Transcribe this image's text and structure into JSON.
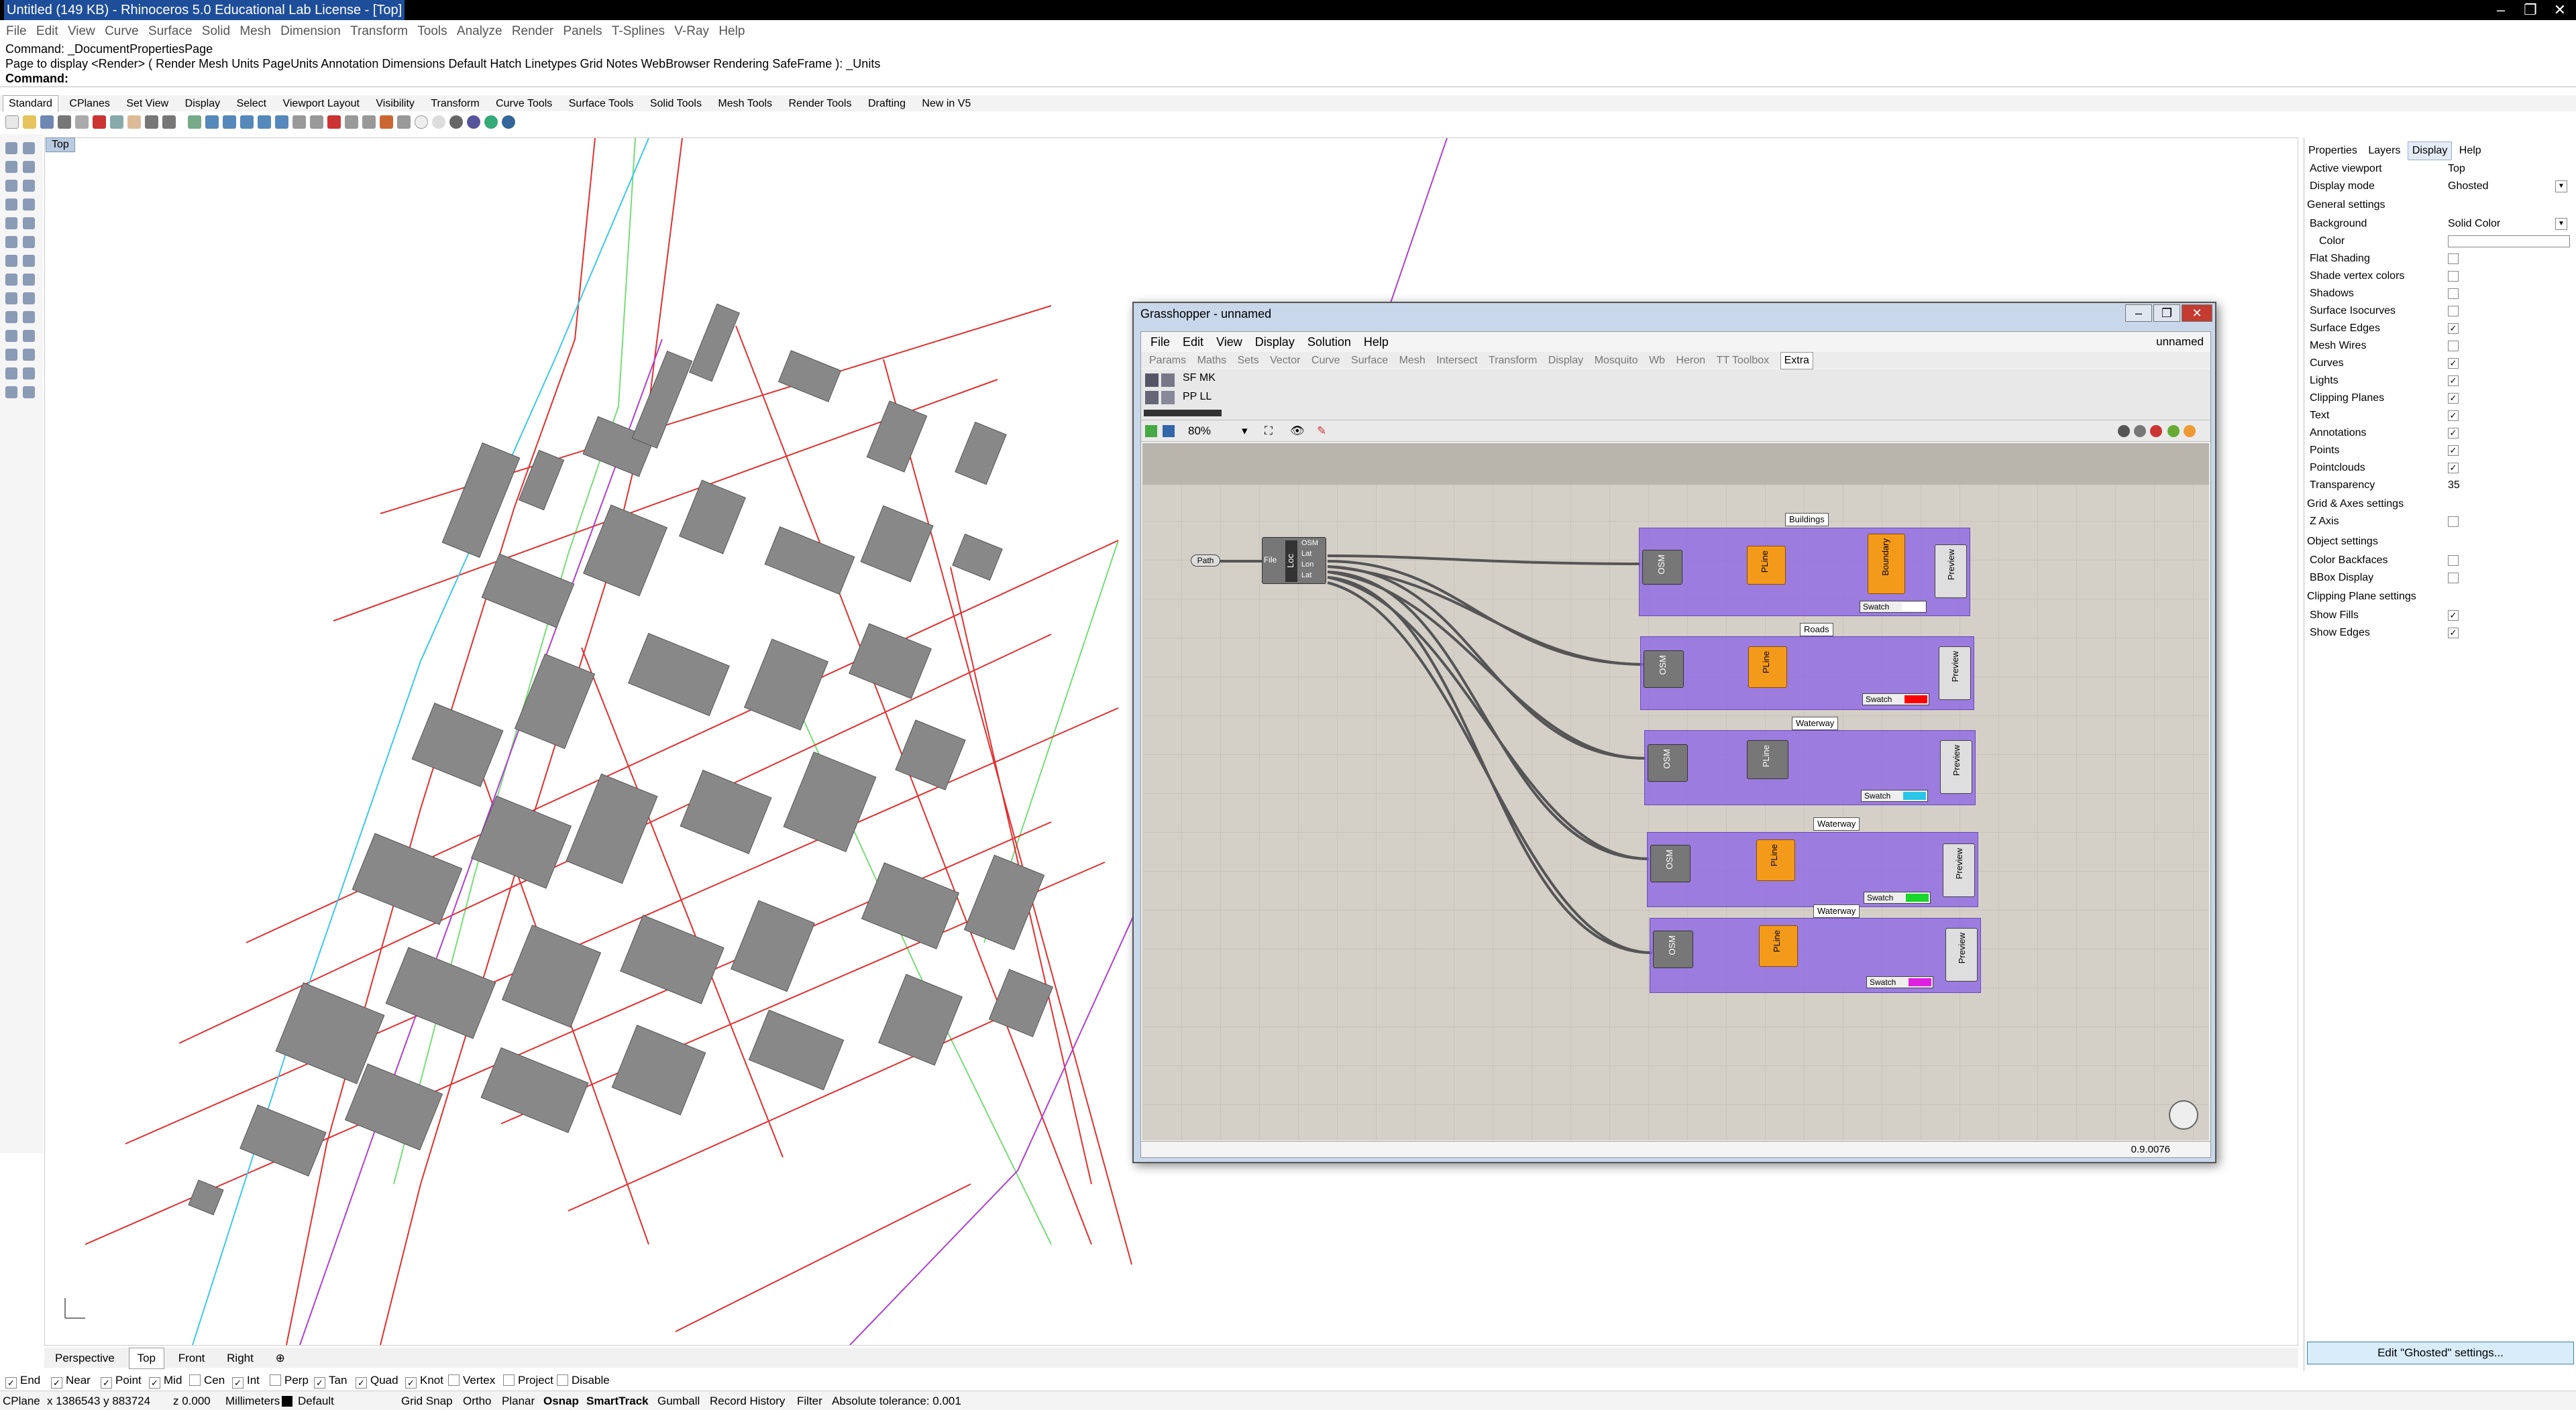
{
  "app": {
    "title": "Untitled (149 KB) - Rhinoceros 5.0 Educational Lab License - [Top]"
  },
  "menubar": [
    "File",
    "Edit",
    "View",
    "Curve",
    "Surface",
    "Solid",
    "Mesh",
    "Dimension",
    "Transform",
    "Tools",
    "Analyze",
    "Render",
    "Panels",
    "T-Splines",
    "V-Ray",
    "Help"
  ],
  "command_history": {
    "line1": "Command: _DocumentPropertiesPage",
    "line2": "Page to display <Render> ( Render  Mesh  Units  PageUnits  Annotation  Dimensions  Default  Hatch  Linetypes  Grid  Notes  WebBrowser  Rendering  SafeFrame ): _Units",
    "prompt": "Command:"
  },
  "toolbar_tabs": [
    "Standard",
    "CPlanes",
    "Set View",
    "Display",
    "Select",
    "Viewport Layout",
    "Visibility",
    "Transform",
    "Curve Tools",
    "Surface Tools",
    "Solid Tools",
    "Mesh Tools",
    "Render Tools",
    "Drafting",
    "New in V5"
  ],
  "viewport": {
    "label": "Top",
    "tabs": [
      "Perspective",
      "Top",
      "Front",
      "Right"
    ]
  },
  "osnaps": [
    {
      "label": "End",
      "checked": true
    },
    {
      "label": "Near",
      "checked": true
    },
    {
      "label": "Point",
      "checked": true
    },
    {
      "label": "Mid",
      "checked": true
    },
    {
      "label": "Cen",
      "checked": false
    },
    {
      "label": "Int",
      "checked": true
    },
    {
      "label": "Perp",
      "checked": false
    },
    {
      "label": "Tan",
      "checked": true
    },
    {
      "label": "Quad",
      "checked": true
    },
    {
      "label": "Knot",
      "checked": true
    },
    {
      "label": "Vertex",
      "checked": false
    },
    {
      "label": "Project",
      "checked": false
    },
    {
      "label": "Disable",
      "checked": false
    }
  ],
  "statusbar": {
    "cplane": "CPlane",
    "coords": "x 1386543  y 883724",
    "z": "z 0.000",
    "units": "Millimeters",
    "layer": "Default",
    "grid_snap": "Grid Snap",
    "ortho": "Ortho",
    "planar": "Planar",
    "osnap": "Osnap",
    "smarttrack": "SmartTrack",
    "gumball": "Gumball",
    "record_history": "Record History",
    "filter": "Filter",
    "tolerance": "Absolute tolerance: 0.001"
  },
  "panel": {
    "tabs": [
      "Properties",
      "Layers",
      "Display",
      "Help"
    ],
    "active_viewport_label": "Active viewport",
    "active_viewport_value": "Top",
    "display_mode_label": "Display mode",
    "display_mode_value": "Ghosted",
    "general_settings": "General settings",
    "background_label": "Background",
    "background_value": "Solid Color",
    "color_label": "Color",
    "checks": [
      {
        "label": "Flat Shading",
        "checked": false
      },
      {
        "label": "Shade vertex colors",
        "checked": false
      },
      {
        "label": "Shadows",
        "checked": false
      },
      {
        "label": "Surface Isocurves",
        "checked": false
      },
      {
        "label": "Surface Edges",
        "checked": true
      },
      {
        "label": "Mesh Wires",
        "checked": false
      },
      {
        "label": "Curves",
        "checked": true
      },
      {
        "label": "Lights",
        "checked": true
      },
      {
        "label": "Clipping Planes",
        "checked": true
      },
      {
        "label": "Text",
        "checked": true
      },
      {
        "label": "Annotations",
        "checked": true
      },
      {
        "label": "Points",
        "checked": true
      },
      {
        "label": "Pointclouds",
        "checked": true
      }
    ],
    "transparency_label": "Transparency",
    "transparency_value": "35",
    "grid_axes_settings": "Grid & Axes settings",
    "z_axis_label": "Z Axis",
    "object_settings": "Object settings",
    "color_backfaces_label": "Color Backfaces",
    "bbox_display_label": "BBox Display",
    "clipping_plane_settings": "Clipping Plane settings",
    "show_fills_label": "Show Fills",
    "show_edges_label": "Show Edges",
    "edit_button": "Edit \"Ghosted\" settings..."
  },
  "grasshopper": {
    "title": "Grasshopper - unnamed",
    "doc_name": "unnamed",
    "menu": [
      "File",
      "Edit",
      "View",
      "Display",
      "Solution",
      "Help"
    ],
    "tabs": [
      "Params",
      "Maths",
      "Sets",
      "Vector",
      "Curve",
      "Surface",
      "Mesh",
      "Intersect",
      "Transform",
      "Display",
      "Mosquito",
      "Wb",
      "Heron",
      "TT Toolbox",
      "Extra"
    ],
    "active_tab": "Extra",
    "ribbon": {
      "r1": "SF MK",
      "r2": "PP LL"
    },
    "zoom": "80%",
    "version": "0.9.0076",
    "groups": [
      {
        "label": "Buildings",
        "swatch": "#ffffff",
        "has_boundary": true
      },
      {
        "label": "Roads",
        "swatch": "#ff0000",
        "has_boundary": false
      },
      {
        "label": "Waterway",
        "swatch": "#29c6e8",
        "has_boundary": false
      },
      {
        "label": "Waterway",
        "swatch": "#19d62c",
        "has_boundary": false
      },
      {
        "label": "Waterway",
        "swatch": "#e020e0",
        "has_boundary": false
      }
    ],
    "path_label": "Path",
    "loc_label": "Loc",
    "loc_ports": [
      "OSM",
      "Lat",
      "Lon",
      "Lat"
    ],
    "file_port": "File",
    "osm_label": "OSM",
    "pline_label": "PLine",
    "boundary_label": "Boundary",
    "preview_label": "Preview",
    "swatch_label": "Swatch"
  }
}
